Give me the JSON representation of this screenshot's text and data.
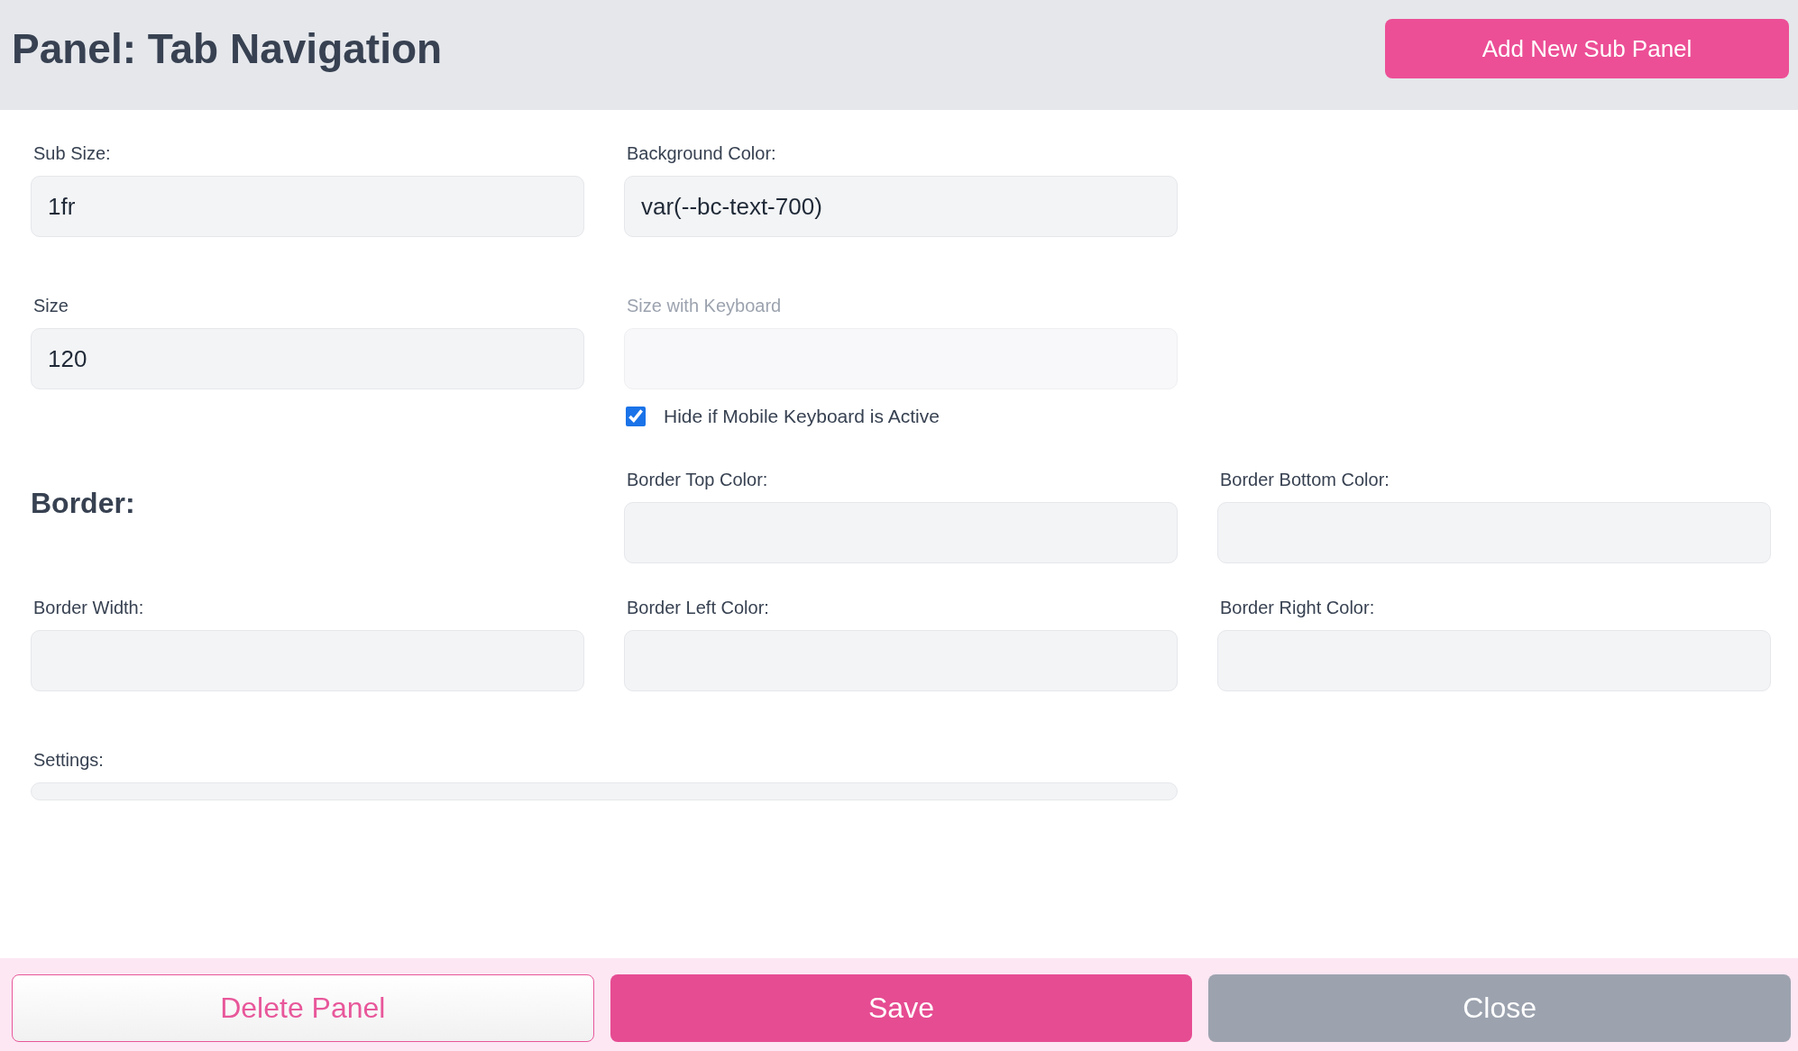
{
  "header": {
    "title": "Panel: Tab Navigation",
    "add_button": "Add New Sub Panel"
  },
  "rows": [
    {
      "cells": [
        {
          "kind": "field",
          "label": "Sub Size:",
          "value": "1fr",
          "disabled": false
        },
        {
          "kind": "field",
          "label": "Background Color:",
          "value": "var(--bc-text-700)",
          "disabled": false
        },
        {
          "kind": "empty"
        }
      ]
    },
    {
      "cells": [
        {
          "kind": "field",
          "label": "Size",
          "value": "120",
          "disabled": false
        },
        {
          "kind": "field",
          "label": "Size with Keyboard",
          "disabled": true,
          "checkbox": {
            "label": "Hide if Mobile Keyboard is Active",
            "checked": true
          }
        },
        {
          "kind": "empty"
        }
      ]
    },
    {
      "cells": [
        {
          "kind": "heading",
          "text": "Border:"
        },
        {
          "kind": "field",
          "label": "Border Top Color:",
          "disabled": false
        },
        {
          "kind": "field",
          "label": "Border Bottom Color:",
          "disabled": false
        }
      ]
    },
    {
      "cells": [
        {
          "kind": "field",
          "label": "Border Width:",
          "disabled": false
        },
        {
          "kind": "field",
          "label": "Border Left Color:",
          "disabled": false
        },
        {
          "kind": "field",
          "label": "Border Right Color:",
          "disabled": false
        }
      ]
    },
    {
      "cells": [
        {
          "kind": "wide-field",
          "label": "Settings:",
          "disabled": false
        }
      ]
    }
  ],
  "footer": {
    "buttons": [
      {
        "kind": "outline",
        "label": "Delete Panel"
      },
      {
        "kind": "primary",
        "label": "Save"
      },
      {
        "kind": "muted",
        "label": "Close"
      }
    ]
  }
}
